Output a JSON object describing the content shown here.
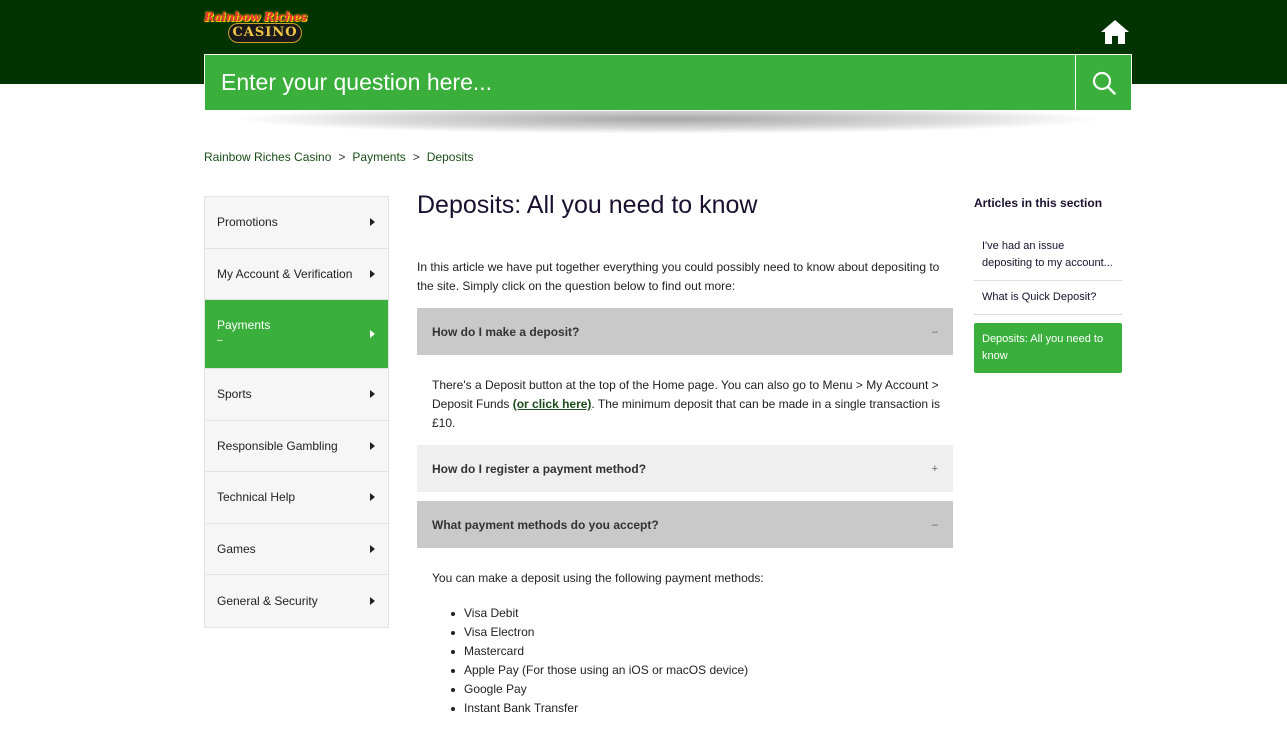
{
  "header": {
    "logo_line1": "Rainbow Riches",
    "logo_line2": "CASINO",
    "home_icon": "home-icon",
    "search_placeholder": "Enter your question here...",
    "search_icon": "search-icon"
  },
  "breadcrumb": [
    "Rainbow Riches Casino",
    "Payments",
    "Deposits"
  ],
  "breadcrumb_sep": ">",
  "sidebar": {
    "items": [
      {
        "label": "Promotions"
      },
      {
        "label": "My Account & Verification"
      },
      {
        "label": "Payments",
        "sub": "–"
      },
      {
        "label": "Sports"
      },
      {
        "label": "Responsible Gambling"
      },
      {
        "label": "Technical Help"
      },
      {
        "label": "Games"
      },
      {
        "label": "General & Security"
      }
    ]
  },
  "article": {
    "title": "Deposits: All you need to know",
    "intro": "In this article we have put together everything you could possibly need to know about depositing to the site. Simply click on the question below to find out more:",
    "accordions": [
      {
        "q": "How do I make a deposit?",
        "sym": "–"
      },
      {
        "q": "How do I register a payment method?",
        "sym": "+"
      },
      {
        "q": "What payment methods do you accept?",
        "sym": "–"
      }
    ],
    "answer1_pre": "There's a Deposit button at the top of the Home page. You can also go to Menu > My Account > Deposit Funds ",
    "answer1_link": "(or click here)",
    "answer1_post": ". The minimum deposit that can be made in a single transaction is £10.",
    "answer3_intro": "You can make a deposit using the following payment methods:",
    "methods": [
      "Visa Debit",
      "Visa Electron",
      "Mastercard",
      "Apple Pay (For those using an iOS or macOS device)",
      "Google Pay",
      "Instant Bank Transfer"
    ]
  },
  "section": {
    "title": "Articles in this section",
    "links": [
      "I've had an issue depositing to my account...",
      "What is Quick Deposit?",
      "Deposits: All you need to know"
    ]
  },
  "colors": {
    "brand_dark": "#003300",
    "brand_green": "#3aaf3c"
  }
}
